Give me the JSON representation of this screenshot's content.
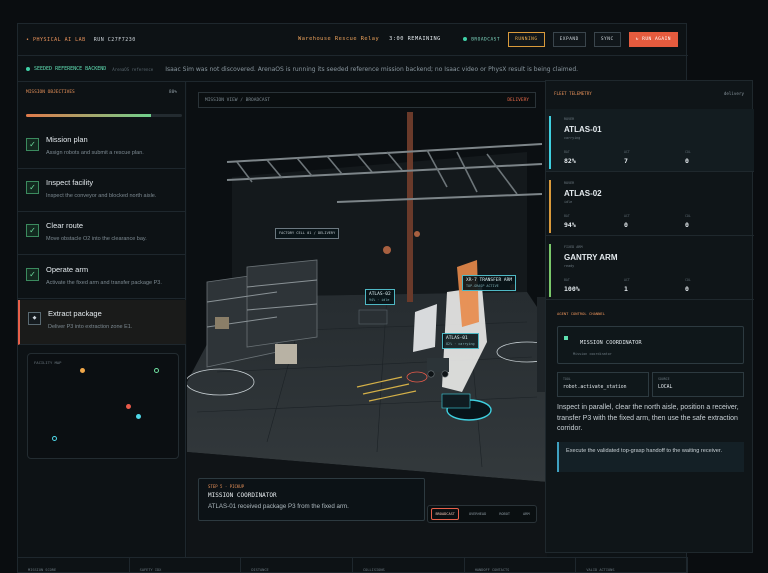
{
  "topbar": {
    "lab": "• PHYSICAL AI LAB",
    "run": "RUN C27F7230",
    "mission": "Warehouse Rescue Relay",
    "remaining": "3:00 REMAINING",
    "broadcast": "BROADCAST",
    "running": "RUNNING",
    "expand": "EXPAND",
    "sync": "SYNC",
    "run_again": "↻ RUN AGAIN"
  },
  "notice": {
    "seed": "SEEDED REFERENCE BACKEND",
    "sub": "ArenaOS reference",
    "message": "Isaac Sim was not discovered. ArenaOS is running its seeded reference mission backend; no Isaac video or PhysX result is being claimed."
  },
  "objectives": {
    "title": "MISSION OBJECTIVES",
    "pct": "80%",
    "progress": 0.8,
    "items": [
      {
        "title": "Mission plan",
        "desc": "Assign robots and submit a rescue plan.",
        "icon": "✓"
      },
      {
        "title": "Inspect facility",
        "desc": "Inspect the conveyor and blocked north aisle.",
        "icon": "✓"
      },
      {
        "title": "Clear route",
        "desc": "Move obstacle O2 into the clearance bay.",
        "icon": "✓"
      },
      {
        "title": "Operate arm",
        "desc": "Activate the fixed arm and transfer package P3.",
        "icon": "✓"
      },
      {
        "title": "Extract package",
        "desc": "Deliver P3 into extraction zone E1.",
        "icon": "◆"
      }
    ]
  },
  "facility_map": {
    "label": "FACILITY MAP"
  },
  "view": {
    "header": "MISSION VIEW / BROADCAST",
    "mode": "DELIVERY",
    "tags": {
      "cell": "FACTORY CELL 01 / DELIVERY",
      "atlas02": "ATLAS-02",
      "atlas02_sub": "94% · idle",
      "arm": "XR-7 TRANSFER ARM",
      "arm_sub": "TOP-GRASP ACTIVE",
      "atlas01": "ATLAS-01",
      "atlas01_sub": "82% · carrying"
    },
    "coordinator": {
      "step": "STEP 5 · PICKUP",
      "title": "MISSION COORDINATOR",
      "message": "ATLAS-01 received package P3 from the fixed arm."
    },
    "cams": [
      "BROADCAST",
      "OVERHEAD",
      "ROBOT",
      "ARM"
    ]
  },
  "telemetry": {
    "title": "FLEET TELEMETRY",
    "mode": "delivery",
    "units": [
      {
        "class": "ROVER",
        "name": "ATLAS-01",
        "state": "carrying",
        "bat_label": "BAT",
        "bat": "82%",
        "act_label": "ACT",
        "act": "7",
        "col_label": "COL",
        "col": "0",
        "color": "#3fd0e0"
      },
      {
        "class": "ROVER",
        "name": "ATLAS-02",
        "state": "idle",
        "bat_label": "BAT",
        "bat": "94%",
        "act_label": "ACT",
        "act": "0",
        "col_label": "COL",
        "col": "0",
        "color": "#d99a3b"
      },
      {
        "class": "FIXED ARM",
        "name": "GANTRY ARM",
        "state": "ready",
        "bat_label": "BAT",
        "bat": "100%",
        "act_label": "ACT",
        "act": "1",
        "col_label": "COL",
        "col": "0",
        "color": "#7ac86a"
      }
    ]
  },
  "agent": {
    "title": "AGENT CONTROL CHANNEL",
    "coordinator": "MISSION COORDINATOR",
    "coordinator_sub": "Mission coordinator",
    "tool_label": "TOOL",
    "tool": "robot.activate_station",
    "source_label": "SOURCE",
    "source": "LOCAL",
    "paragraph": "Inspect in parallel, clear the north aisle, position a receiver, transfer P3 with the fixed arm, then use the safe extraction corridor.",
    "note": "Execute the validated top-grasp handoff to the waiting receiver."
  },
  "bottom": [
    "MISSION SCORE",
    "SAFETY IDX",
    "DISTANCE",
    "COLLISIONS",
    "HANDOFF CONTACTS",
    "VALID ACTIONS"
  ]
}
